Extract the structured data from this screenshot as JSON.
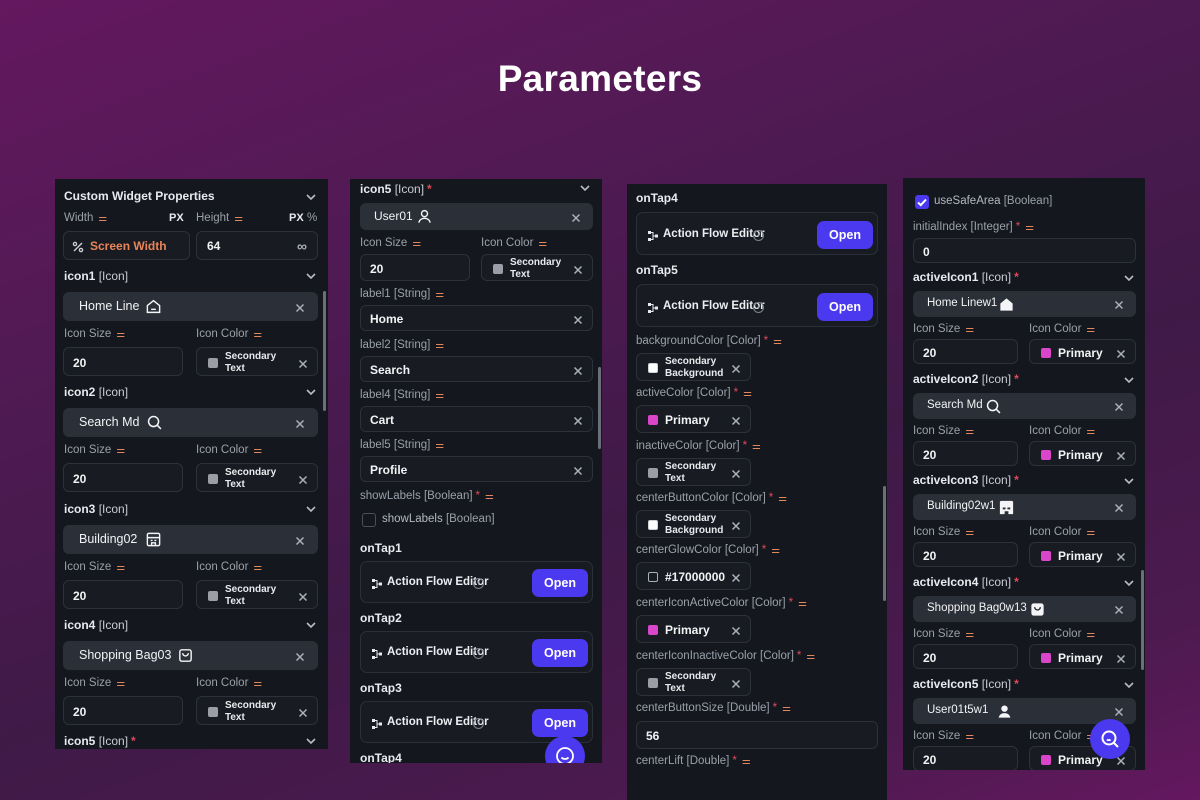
{
  "page": {
    "title": "Parameters"
  },
  "p1": {
    "header": "Custom Widget Properties",
    "width_label": "Width",
    "height_label": "Height",
    "px": "PX",
    "px2": "PX",
    "pct": "%",
    "width_value": "Screen Width",
    "height_value": "64",
    "infinity": "∞",
    "icons": [
      {
        "header": "icon1",
        "type": "[Icon]",
        "value": "Home Line",
        "size": "20",
        "color_l1": "Secondary",
        "color_l2": "Text"
      },
      {
        "header": "icon2",
        "type": "[Icon]",
        "value": "Search Md",
        "size": "20",
        "color_l1": "Secondary",
        "color_l2": "Text"
      },
      {
        "header": "icon3",
        "type": "[Icon]",
        "value": "Building02",
        "size": "20",
        "color_l1": "Secondary",
        "color_l2": "Text"
      },
      {
        "header": "icon4",
        "type": "[Icon]",
        "value": "Shopping Bag03",
        "size": "20",
        "color_l1": "Secondary",
        "color_l2": "Text"
      }
    ],
    "icon_size_label": "Icon Size",
    "icon_color_label": "Icon Color",
    "icon5": {
      "header": "icon5",
      "type": "[Icon]",
      "star": "*"
    }
  },
  "p2": {
    "icon5": {
      "header": "icon5",
      "type": "[Icon]",
      "star": "*",
      "value": "User01"
    },
    "icon_size_label": "Icon Size",
    "icon_size": "20",
    "icon_color_label": "Icon Color",
    "color_l1": "Secondary",
    "color_l2": "Text",
    "labels": [
      {
        "name": "label1",
        "type": "[String]",
        "value": "Home"
      },
      {
        "name": "label2",
        "type": "[String]",
        "value": "Search"
      },
      {
        "name": "label4",
        "type": "[String]",
        "value": "Cart"
      },
      {
        "name": "label5",
        "type": "[String]",
        "value": "Profile"
      }
    ],
    "showLabels": {
      "name": "showLabels",
      "type": "[Boolean]",
      "star": "*",
      "cb_label": "showLabels",
      "cb_type": "[Boolean]"
    },
    "taps": [
      {
        "header": "onTap1",
        "editor": "Action Flow Editor",
        "open": "Open"
      },
      {
        "header": "onTap2",
        "editor": "Action Flow Editor",
        "open": "Open"
      },
      {
        "header": "onTap3",
        "editor": "Action Flow Editor",
        "open": "Open"
      }
    ],
    "tap4": "onTap4"
  },
  "p3": {
    "taps": [
      {
        "header": "onTap4",
        "editor": "Action Flow Editor",
        "open": "Open"
      },
      {
        "header": "onTap5",
        "editor": "Action Flow Editor",
        "open": "Open"
      }
    ],
    "colors": [
      {
        "name": "backgroundColor",
        "type": "[Color]",
        "star": "*",
        "l1": "Secondary",
        "l2": "Background",
        "swatch": "#ffffff"
      },
      {
        "name": "activeColor",
        "type": "[Color]",
        "star": "*",
        "l1": "Primary",
        "l2": "",
        "swatch": "#d946c9"
      },
      {
        "name": "inactiveColor",
        "type": "[Color]",
        "star": "*",
        "l1": "Secondary",
        "l2": "Text",
        "swatch": "#9b9ea6"
      },
      {
        "name": "centerButtonColor",
        "type": "[Color]",
        "star": "*",
        "l1": "Secondary",
        "l2": "Background",
        "swatch": "#ffffff"
      },
      {
        "name": "centerGlowColor",
        "type": "[Color]",
        "star": "*",
        "l1": "#17000000",
        "l2": "",
        "swatch": "#17000000"
      },
      {
        "name": "centerIconActiveColor",
        "type": "[Color]",
        "star": "*",
        "l1": "Primary",
        "l2": "",
        "swatch": "#d946c9"
      },
      {
        "name": "centerIconInactiveColor",
        "type": "[Color]",
        "star": "*",
        "l1": "Secondary",
        "l2": "Text",
        "swatch": "#9b9ea6"
      }
    ],
    "centerButtonSize": {
      "name": "centerButtonSize",
      "type": "[Double]",
      "star": "*",
      "value": "56"
    },
    "centerLift": {
      "name": "centerLift",
      "type": "[Double]",
      "star": "*"
    }
  },
  "p4": {
    "useSafeArea": {
      "name": "useSafeArea",
      "type": "[Boolean]"
    },
    "initialIndex": {
      "name": "initialIndex",
      "type": "[Integer]",
      "star": "*",
      "value": "0"
    },
    "icon_size_label": "Icon Size",
    "icon_color_label": "Icon Color",
    "active": [
      {
        "name": "activeIcon1",
        "type": "[Icon]",
        "star": "*",
        "value": "Home Linew1",
        "size": "20",
        "color": "Primary"
      },
      {
        "name": "activeIcon2",
        "type": "[Icon]",
        "star": "*",
        "value": "Search Md",
        "size": "20",
        "color": "Primary"
      },
      {
        "name": "activeIcon3",
        "type": "[Icon]",
        "star": "*",
        "value": "Building02w1",
        "size": "20",
        "color": "Primary"
      },
      {
        "name": "activeIcon4",
        "type": "[Icon]",
        "star": "*",
        "value": "Shopping Bag0w13",
        "size": "20",
        "color": "Primary"
      },
      {
        "name": "activeIcon5",
        "type": "[Icon]",
        "star": "*",
        "value": "User01t5w1",
        "size": "20",
        "color": "Primary"
      }
    ]
  },
  "colors": {
    "accent": "#4b39ef",
    "primary_swatch": "#d946c9",
    "secondary_text_swatch": "#9b9ea6",
    "label_orange": "#e2875b"
  }
}
